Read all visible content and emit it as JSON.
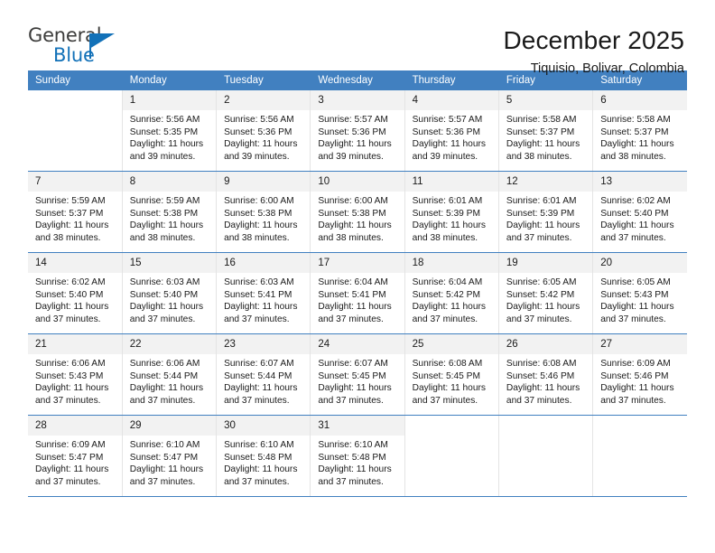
{
  "brand": {
    "name_part1": "General",
    "name_part2": "Blue",
    "logo_icon": "blue-triangle-flag-icon",
    "accent_color": "#1271b8"
  },
  "header": {
    "title": "December 2025",
    "subtitle": "Tiquisio, Bolivar, Colombia"
  },
  "colors": {
    "header_row_blue": "#4180c0",
    "day_band_gray": "#f2f2f2",
    "grid_divider": "#e4e4e4",
    "text": "#1a1a1a"
  },
  "calendar": {
    "weekday_headers": [
      "Sunday",
      "Monday",
      "Tuesday",
      "Wednesday",
      "Thursday",
      "Friday",
      "Saturday"
    ],
    "weeks": [
      [
        {
          "day": "",
          "sunrise": "",
          "sunset": "",
          "daylight_line1": "",
          "daylight_line2": ""
        },
        {
          "day": "1",
          "sunrise": "Sunrise: 5:56 AM",
          "sunset": "Sunset: 5:35 PM",
          "daylight_line1": "Daylight: 11 hours",
          "daylight_line2": "and 39 minutes."
        },
        {
          "day": "2",
          "sunrise": "Sunrise: 5:56 AM",
          "sunset": "Sunset: 5:36 PM",
          "daylight_line1": "Daylight: 11 hours",
          "daylight_line2": "and 39 minutes."
        },
        {
          "day": "3",
          "sunrise": "Sunrise: 5:57 AM",
          "sunset": "Sunset: 5:36 PM",
          "daylight_line1": "Daylight: 11 hours",
          "daylight_line2": "and 39 minutes."
        },
        {
          "day": "4",
          "sunrise": "Sunrise: 5:57 AM",
          "sunset": "Sunset: 5:36 PM",
          "daylight_line1": "Daylight: 11 hours",
          "daylight_line2": "and 39 minutes."
        },
        {
          "day": "5",
          "sunrise": "Sunrise: 5:58 AM",
          "sunset": "Sunset: 5:37 PM",
          "daylight_line1": "Daylight: 11 hours",
          "daylight_line2": "and 38 minutes."
        },
        {
          "day": "6",
          "sunrise": "Sunrise: 5:58 AM",
          "sunset": "Sunset: 5:37 PM",
          "daylight_line1": "Daylight: 11 hours",
          "daylight_line2": "and 38 minutes."
        }
      ],
      [
        {
          "day": "7",
          "sunrise": "Sunrise: 5:59 AM",
          "sunset": "Sunset: 5:37 PM",
          "daylight_line1": "Daylight: 11 hours",
          "daylight_line2": "and 38 minutes."
        },
        {
          "day": "8",
          "sunrise": "Sunrise: 5:59 AM",
          "sunset": "Sunset: 5:38 PM",
          "daylight_line1": "Daylight: 11 hours",
          "daylight_line2": "and 38 minutes."
        },
        {
          "day": "9",
          "sunrise": "Sunrise: 6:00 AM",
          "sunset": "Sunset: 5:38 PM",
          "daylight_line1": "Daylight: 11 hours",
          "daylight_line2": "and 38 minutes."
        },
        {
          "day": "10",
          "sunrise": "Sunrise: 6:00 AM",
          "sunset": "Sunset: 5:38 PM",
          "daylight_line1": "Daylight: 11 hours",
          "daylight_line2": "and 38 minutes."
        },
        {
          "day": "11",
          "sunrise": "Sunrise: 6:01 AM",
          "sunset": "Sunset: 5:39 PM",
          "daylight_line1": "Daylight: 11 hours",
          "daylight_line2": "and 38 minutes."
        },
        {
          "day": "12",
          "sunrise": "Sunrise: 6:01 AM",
          "sunset": "Sunset: 5:39 PM",
          "daylight_line1": "Daylight: 11 hours",
          "daylight_line2": "and 37 minutes."
        },
        {
          "day": "13",
          "sunrise": "Sunrise: 6:02 AM",
          "sunset": "Sunset: 5:40 PM",
          "daylight_line1": "Daylight: 11 hours",
          "daylight_line2": "and 37 minutes."
        }
      ],
      [
        {
          "day": "14",
          "sunrise": "Sunrise: 6:02 AM",
          "sunset": "Sunset: 5:40 PM",
          "daylight_line1": "Daylight: 11 hours",
          "daylight_line2": "and 37 minutes."
        },
        {
          "day": "15",
          "sunrise": "Sunrise: 6:03 AM",
          "sunset": "Sunset: 5:40 PM",
          "daylight_line1": "Daylight: 11 hours",
          "daylight_line2": "and 37 minutes."
        },
        {
          "day": "16",
          "sunrise": "Sunrise: 6:03 AM",
          "sunset": "Sunset: 5:41 PM",
          "daylight_line1": "Daylight: 11 hours",
          "daylight_line2": "and 37 minutes."
        },
        {
          "day": "17",
          "sunrise": "Sunrise: 6:04 AM",
          "sunset": "Sunset: 5:41 PM",
          "daylight_line1": "Daylight: 11 hours",
          "daylight_line2": "and 37 minutes."
        },
        {
          "day": "18",
          "sunrise": "Sunrise: 6:04 AM",
          "sunset": "Sunset: 5:42 PM",
          "daylight_line1": "Daylight: 11 hours",
          "daylight_line2": "and 37 minutes."
        },
        {
          "day": "19",
          "sunrise": "Sunrise: 6:05 AM",
          "sunset": "Sunset: 5:42 PM",
          "daylight_line1": "Daylight: 11 hours",
          "daylight_line2": "and 37 minutes."
        },
        {
          "day": "20",
          "sunrise": "Sunrise: 6:05 AM",
          "sunset": "Sunset: 5:43 PM",
          "daylight_line1": "Daylight: 11 hours",
          "daylight_line2": "and 37 minutes."
        }
      ],
      [
        {
          "day": "21",
          "sunrise": "Sunrise: 6:06 AM",
          "sunset": "Sunset: 5:43 PM",
          "daylight_line1": "Daylight: 11 hours",
          "daylight_line2": "and 37 minutes."
        },
        {
          "day": "22",
          "sunrise": "Sunrise: 6:06 AM",
          "sunset": "Sunset: 5:44 PM",
          "daylight_line1": "Daylight: 11 hours",
          "daylight_line2": "and 37 minutes."
        },
        {
          "day": "23",
          "sunrise": "Sunrise: 6:07 AM",
          "sunset": "Sunset: 5:44 PM",
          "daylight_line1": "Daylight: 11 hours",
          "daylight_line2": "and 37 minutes."
        },
        {
          "day": "24",
          "sunrise": "Sunrise: 6:07 AM",
          "sunset": "Sunset: 5:45 PM",
          "daylight_line1": "Daylight: 11 hours",
          "daylight_line2": "and 37 minutes."
        },
        {
          "day": "25",
          "sunrise": "Sunrise: 6:08 AM",
          "sunset": "Sunset: 5:45 PM",
          "daylight_line1": "Daylight: 11 hours",
          "daylight_line2": "and 37 minutes."
        },
        {
          "day": "26",
          "sunrise": "Sunrise: 6:08 AM",
          "sunset": "Sunset: 5:46 PM",
          "daylight_line1": "Daylight: 11 hours",
          "daylight_line2": "and 37 minutes."
        },
        {
          "day": "27",
          "sunrise": "Sunrise: 6:09 AM",
          "sunset": "Sunset: 5:46 PM",
          "daylight_line1": "Daylight: 11 hours",
          "daylight_line2": "and 37 minutes."
        }
      ],
      [
        {
          "day": "28",
          "sunrise": "Sunrise: 6:09 AM",
          "sunset": "Sunset: 5:47 PM",
          "daylight_line1": "Daylight: 11 hours",
          "daylight_line2": "and 37 minutes."
        },
        {
          "day": "29",
          "sunrise": "Sunrise: 6:10 AM",
          "sunset": "Sunset: 5:47 PM",
          "daylight_line1": "Daylight: 11 hours",
          "daylight_line2": "and 37 minutes."
        },
        {
          "day": "30",
          "sunrise": "Sunrise: 6:10 AM",
          "sunset": "Sunset: 5:48 PM",
          "daylight_line1": "Daylight: 11 hours",
          "daylight_line2": "and 37 minutes."
        },
        {
          "day": "31",
          "sunrise": "Sunrise: 6:10 AM",
          "sunset": "Sunset: 5:48 PM",
          "daylight_line1": "Daylight: 11 hours",
          "daylight_line2": "and 37 minutes."
        },
        {
          "day": "",
          "sunrise": "",
          "sunset": "",
          "daylight_line1": "",
          "daylight_line2": ""
        },
        {
          "day": "",
          "sunrise": "",
          "sunset": "",
          "daylight_line1": "",
          "daylight_line2": ""
        },
        {
          "day": "",
          "sunrise": "",
          "sunset": "",
          "daylight_line1": "",
          "daylight_line2": ""
        }
      ]
    ]
  }
}
